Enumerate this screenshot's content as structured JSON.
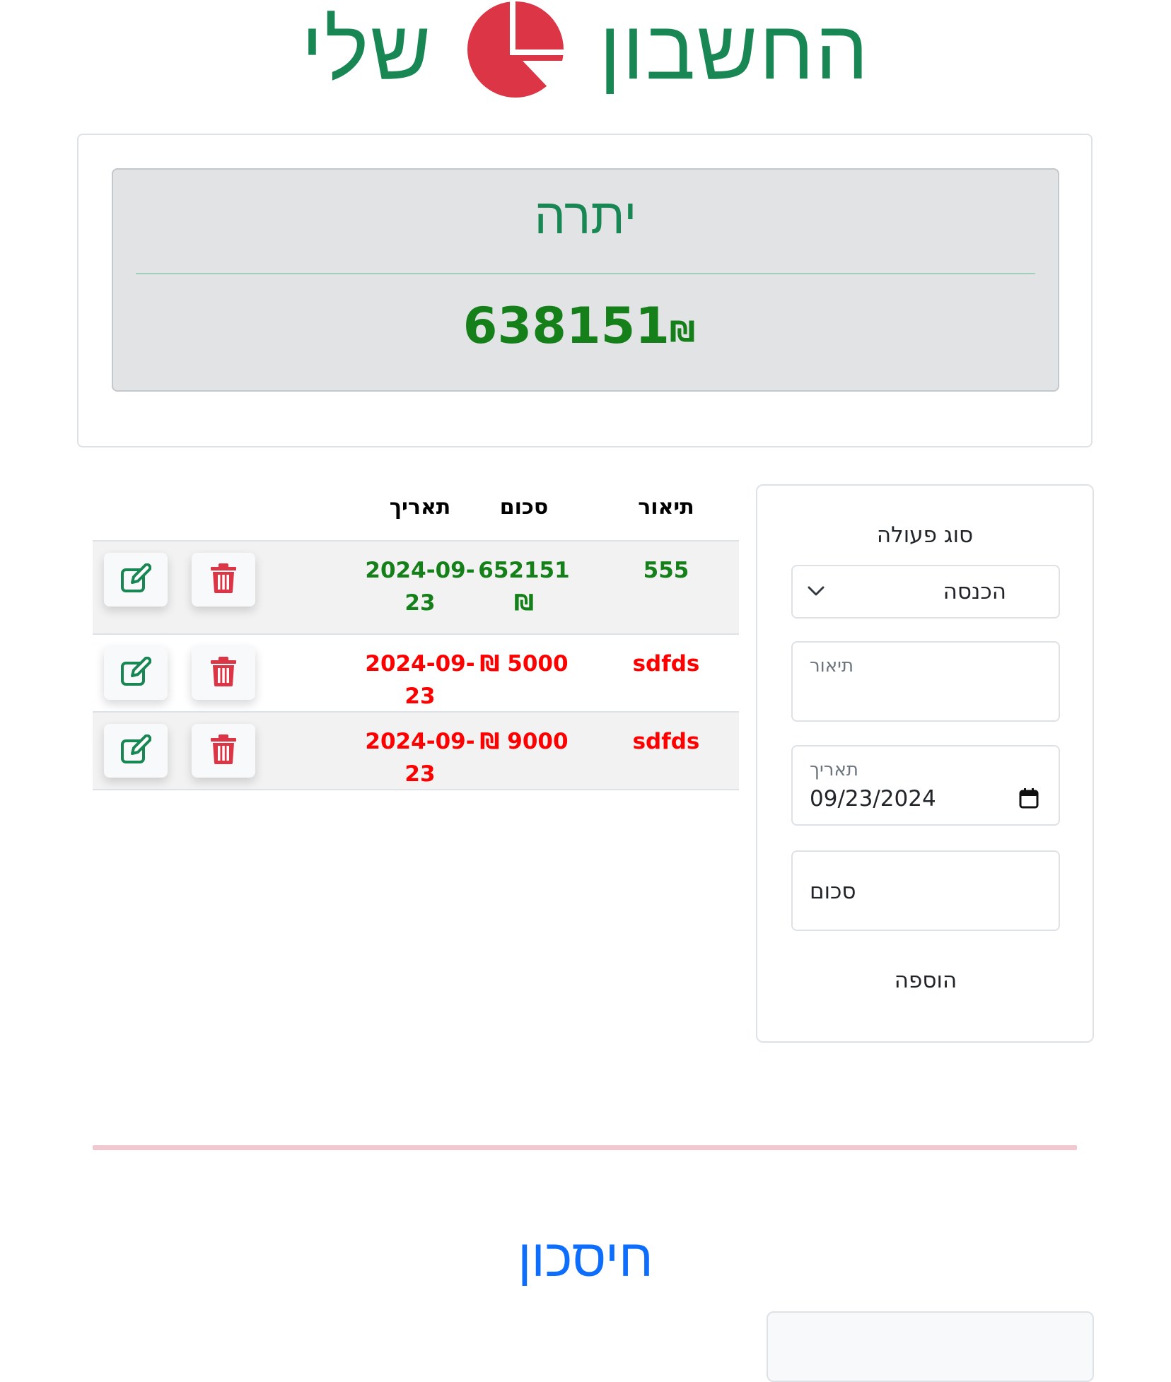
{
  "header": {
    "title_part1": "החשבון",
    "title_part2": "שלי",
    "logo_icon": "pie-chart-icon",
    "title_color": "#198754",
    "logo_color": "#dc3545"
  },
  "balance": {
    "title": "יתרה",
    "amount": "638151",
    "currency": "₪"
  },
  "table": {
    "headers": {
      "description": "תיאור",
      "amount": "סכום",
      "date": "תאריך"
    },
    "rows": [
      {
        "description": "555",
        "amount": "652151",
        "currency": "₪",
        "date": "2024-09-23",
        "type": "income",
        "color": "#15801a"
      },
      {
        "description": "sdfds",
        "amount": "5000",
        "currency": "₪",
        "date": "2024-09-23",
        "type": "expense",
        "color": "#ff0000"
      },
      {
        "description": "sdfds",
        "amount": "9000",
        "currency": "₪",
        "date": "2024-09-23",
        "type": "expense",
        "color": "#ff0000"
      }
    ],
    "edit_icon": "edit-icon",
    "delete_icon": "trash-icon"
  },
  "form": {
    "type_label": "סוג פעולה",
    "type_selected": "הכנסה",
    "description_label": "תיאור",
    "date_label": "תאריך",
    "date_value": "09/23/2024",
    "amount_placeholder": "סכום",
    "add_label": "הוספה"
  },
  "savings": {
    "title": "חיסכון"
  }
}
